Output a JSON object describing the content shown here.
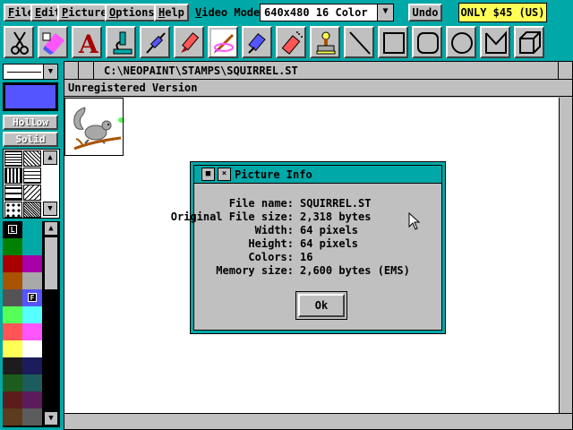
{
  "menu": {
    "items": [
      {
        "label": "File",
        "accel": "F",
        "rest": "ile"
      },
      {
        "label": "Edit",
        "accel": "E",
        "rest": "dit"
      },
      {
        "label": "Picture",
        "accel": "P",
        "rest": "icture"
      },
      {
        "label": "Options",
        "accel": "O",
        "rest": "ptions"
      },
      {
        "label": "Help",
        "accel": "H",
        "rest": "elp"
      }
    ]
  },
  "video_mode": {
    "label_accel": "V",
    "label_rest": "ideo Mode:",
    "value": "640x480 16 Color"
  },
  "undo_label": "Undo",
  "promo_label": "ONLY $45 (US)",
  "tools": [
    "scissors-icon",
    "eraser-icon",
    "text-icon",
    "microscope-icon",
    "syringe-icon",
    "marker-icon",
    "brush-icon",
    "paint-tube-icon",
    "spray-can-icon",
    "stamp-icon",
    "line-icon",
    "rectangle-icon",
    "rounded-rectangle-icon",
    "ellipse-icon",
    "polygon-icon",
    "cube-icon"
  ],
  "fill": {
    "hollow": "Hollow",
    "solid": "Solid"
  },
  "palette": {
    "left_marker": "L",
    "right_marker": "F",
    "colors": [
      [
        "#000000",
        "#00a8a8"
      ],
      [
        "#008000",
        "#00a8a8"
      ],
      [
        "#a80000",
        "#a800a8"
      ],
      [
        "#a85400",
        "#a8a8a8"
      ],
      [
        "#545454",
        "#5555ff"
      ],
      [
        "#55ff55",
        "#55ffff"
      ],
      [
        "#ff5555",
        "#ff55ff"
      ],
      [
        "#ffff55",
        "#ffffff"
      ],
      [
        "#1c1c1c",
        "#1c1c5c"
      ],
      [
        "#1c5c1c",
        "#1c5c5c"
      ],
      [
        "#5c1c1c",
        "#5c1c5c"
      ],
      [
        "#5c3c1c",
        "#5c5c5c"
      ]
    ]
  },
  "document": {
    "path": "C:\\NEOPAINT\\STAMPS\\SQUIRREL.ST",
    "banner": "Unregistered Version"
  },
  "dialog": {
    "title": "Picture Info",
    "rows": [
      {
        "label": "File name:",
        "value": "SQUIRREL.ST"
      },
      {
        "label": "Original File size:",
        "value": "2,318 bytes"
      },
      {
        "label": "Width:",
        "value": "64 pixels"
      },
      {
        "label": "Height:",
        "value": "64 pixels"
      },
      {
        "label": "Colors:",
        "value": "16"
      },
      {
        "label": "Memory size:",
        "value": "2,600 bytes (EMS)"
      }
    ],
    "ok_label": "Ok"
  }
}
